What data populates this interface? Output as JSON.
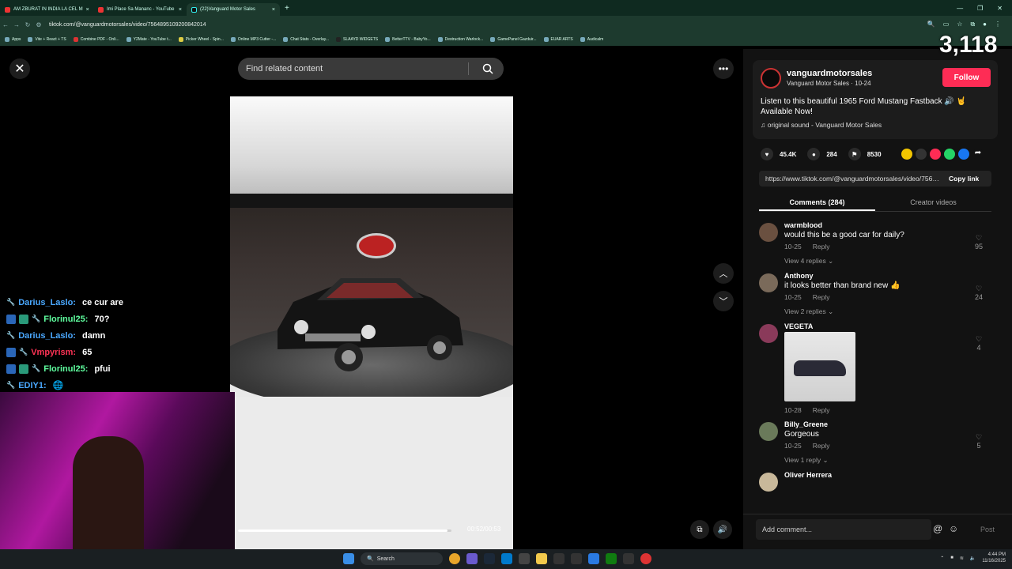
{
  "browser": {
    "tabs": [
      {
        "label": "AM ZBURAT IN INDIA LA CEL M",
        "close": "×"
      },
      {
        "label": "Imi Place Sa Mananc - YouTube",
        "close": "×"
      },
      {
        "label": "(22)Vanguard Motor Sales",
        "close": "×"
      }
    ],
    "new_tab": "+",
    "url": "tiktok.com/@vanguardmotorsales/video/7564895109200842014",
    "bookmarks": [
      "Apps",
      "Vite + React + TS",
      "Combine PDF - Onli...",
      "Y2Mate - YouTube t...",
      "Picker Wheel - Spin...",
      "Online MP3 Cutter -...",
      "Chat Stats - Overlay...",
      "SLAAYD WIDGETS",
      "BetterTTV - BabyYo...",
      "Destruction Warlock...",
      "GamePanel Gazduir...",
      "EUAR ARTS",
      "Audicalm"
    ]
  },
  "video": {
    "search_placeholder": "Find related content",
    "progress_fraction": 0.98,
    "timecode": "00:52/00:53"
  },
  "overlay": {
    "viewer_count": "3,118",
    "chat": [
      {
        "user": "Darius_Laslo:",
        "msg": "ce cur are",
        "color": "#4aa8ff"
      },
      {
        "user": "Florinul25:",
        "msg": "70?",
        "color": "#5fff9f"
      },
      {
        "user": "Darius_Laslo:",
        "msg": "damn",
        "color": "#4aa8ff"
      },
      {
        "user": "Vmpyrism:",
        "msg": "65",
        "color": "#ff3355"
      },
      {
        "user": "Florinul25:",
        "msg": "pfui",
        "color": "#5fff9f"
      },
      {
        "user": "EDIY1:",
        "msg": "",
        "color": "#4aa8ff"
      }
    ]
  },
  "author": {
    "handle": "vanguardmotorsales",
    "subline": "Vanguard Motor Sales · 10-24",
    "follow_label": "Follow",
    "caption": "Listen to this beautiful 1965 Ford Mustang Fastback 🔊 🤘 Available Now!",
    "music": "♫  original sound - Vanguard Motor Sales"
  },
  "stats": {
    "likes": "45.4K",
    "comments": "284",
    "saves": "8530"
  },
  "share": {
    "link": "https://www.tiktok.com/@vanguardmotorsales/video/7564895109200842014",
    "copy_label": "Copy link"
  },
  "tabs": {
    "comments": "Comments (284)",
    "creator": "Creator videos"
  },
  "comments": [
    {
      "user": "warmblood",
      "text": "would this be a good car for daily?",
      "date": "10-25",
      "reply": "Reply",
      "replies": "View 4 replies ⌄",
      "likes": "95"
    },
    {
      "user": "Anthony",
      "text": "it looks better than brand new 👍",
      "date": "10-25",
      "reply": "Reply",
      "replies": "View 2 replies ⌄",
      "likes": "24"
    },
    {
      "user": "VEGETA",
      "text": "",
      "date": "10-28",
      "reply": "Reply",
      "replies": "",
      "likes": "4"
    },
    {
      "user": "Billy_Greene",
      "text": "Gorgeous",
      "date": "10-25",
      "reply": "Reply",
      "replies": "View 1 reply ⌄",
      "likes": "5"
    },
    {
      "user": "Oliver Herrera",
      "text": "",
      "date": "",
      "reply": "",
      "replies": "",
      "likes": ""
    }
  ],
  "add_comment": {
    "placeholder": "Add comment...",
    "post": "Post"
  },
  "taskbar": {
    "search": "Search",
    "time": "4:44 PM",
    "date": "11/16/2025"
  },
  "colors": {
    "accent": "#fe2c55",
    "panel": "#121212"
  }
}
